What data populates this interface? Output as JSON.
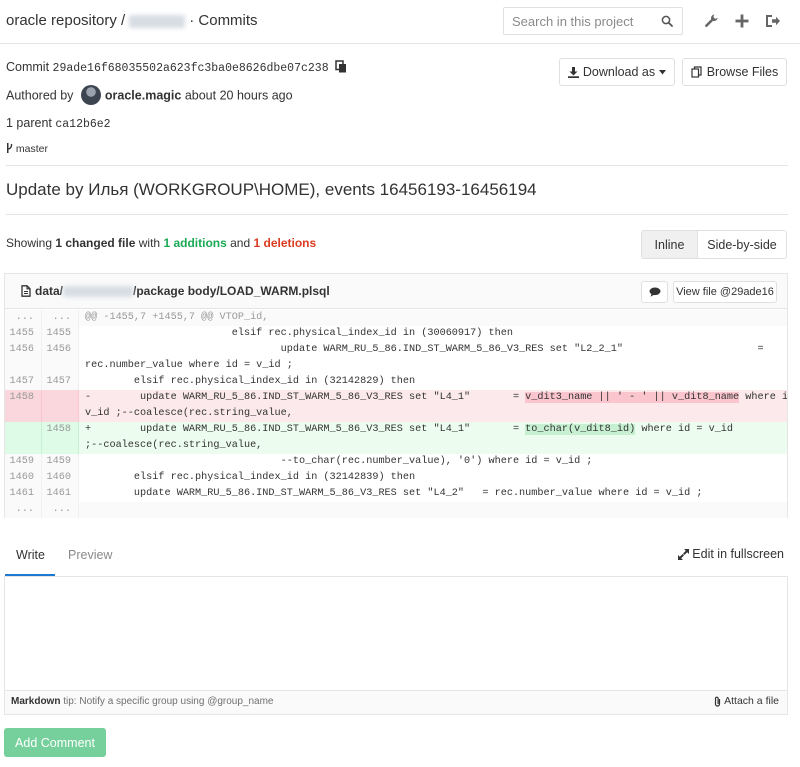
{
  "header": {
    "project": "oracle repository /",
    "separator": "·",
    "page": "Commits",
    "search_placeholder": "Search in this project"
  },
  "commit": {
    "label": "Commit",
    "sha": "29ade16f68035502a623fc3ba0e8626dbe07c238",
    "authored_by": "Authored by",
    "author": "oracle.magic",
    "time": "about 20 hours ago",
    "parent_label": "1 parent",
    "parent_sha": "ca12b6e2",
    "branch": "master",
    "download_label": "Download as",
    "browse_label": "Browse Files",
    "title": "Update by Илья (WORKGROUP\\HOME), events 16456193-16456194"
  },
  "stats": {
    "showing": "Showing",
    "changed": "1 changed file",
    "with": "with",
    "additions": "1 additions",
    "and": "and",
    "deletions": "1 deletions"
  },
  "view_toggle": {
    "inline": "Inline",
    "side_by_side": "Side-by-side"
  },
  "file": {
    "path_prefix": "data/",
    "path_suffix": "/package body/LOAD_WARM.plsql",
    "view_file": "View file @29ade16"
  },
  "diff": [
    {
      "type": "match",
      "old": "...",
      "new": "...",
      "text": "@@ -1455,7 +1455,7 @@ VTOP_id,"
    },
    {
      "type": "context",
      "old": "1455",
      "new": "1455",
      "text": "                        elsif rec.physical_index_id in (30060917) then"
    },
    {
      "type": "context",
      "old": "1456",
      "new": "1456",
      "text": "                                update WARM_RU_5_86.IND_ST_WARM_5_86_V3_RES set \"L2_2_1\"                      ="
    },
    {
      "type": "context",
      "old": "",
      "new": "",
      "text": "rec.number_value where id = v_id ;"
    },
    {
      "type": "context",
      "old": "1457",
      "new": "1457",
      "text": "        elsif rec.physical_index_id in (32142829) then"
    },
    {
      "type": "old",
      "old": "1458",
      "new": "",
      "text_a": "-        update WARM_RU_5_86.IND_ST_WARM_5_86_V3_RES set \"L4_1\"       = ",
      "hl": "v_dit3_name || ' - ' || v_dit8_name",
      "text_b": " where id ="
    },
    {
      "type": "old",
      "old": "",
      "new": "",
      "text": "v_id ;--coalesce(rec.string_value,"
    },
    {
      "type": "new",
      "old": "",
      "new": "1458",
      "text_a": "+        update WARM_RU_5_86.IND_ST_WARM_5_86_V3_RES set \"L4_1\"       = ",
      "hl": "to_char(v_dit8_id)",
      "text_b": " where id = v_id"
    },
    {
      "type": "new",
      "old": "",
      "new": "",
      "text": ";--coalesce(rec.string_value,"
    },
    {
      "type": "context",
      "old": "1459",
      "new": "1459",
      "text": "                                --to_char(rec.number_value), '0') where id = v_id ;"
    },
    {
      "type": "context",
      "old": "1460",
      "new": "1460",
      "text": "        elsif rec.physical_index_id in (32142839) then"
    },
    {
      "type": "context",
      "old": "1461",
      "new": "1461",
      "text": "        update WARM_RU_5_86.IND_ST_WARM_5_86_V3_RES set \"L4_2\"   = rec.number_value where id = v_id ;"
    },
    {
      "type": "match",
      "old": "...",
      "new": "...",
      "text": ""
    }
  ],
  "comment": {
    "write_tab": "Write",
    "preview_tab": "Preview",
    "fullscreen": "Edit in fullscreen",
    "md_label": "Markdown",
    "md_tip": "tip: Notify a specific group using @group_name",
    "attach": "Attach a file",
    "submit": "Add Comment"
  },
  "colors": {
    "addition": "#1aaa55",
    "deletion": "#db3b21",
    "submit": "#75d09b",
    "active_tab": "#1f78d1"
  }
}
